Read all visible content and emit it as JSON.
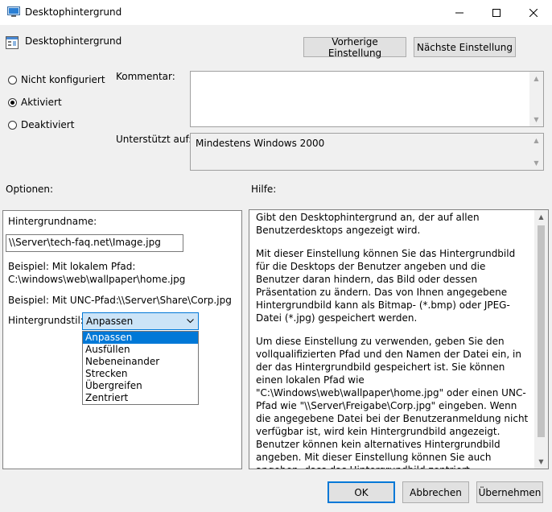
{
  "window": {
    "title": "Desktophintergrund",
    "minimize_icon": "minimize-icon",
    "maximize_icon": "maximize-icon",
    "close_icon": "close-icon"
  },
  "header": {
    "setting_name": "Desktophintergrund",
    "prev_button": "Vorherige Einstellung",
    "next_button": "Nächste Einstellung"
  },
  "state": {
    "options": [
      {
        "label": "Nicht konfiguriert",
        "checked": false
      },
      {
        "label": "Aktiviert",
        "checked": true
      },
      {
        "label": "Deaktiviert",
        "checked": false
      }
    ]
  },
  "comment": {
    "label": "Kommentar:",
    "value": ""
  },
  "supported": {
    "label": "Unterstützt auf:",
    "value": "Mindestens Windows 2000"
  },
  "options_section": {
    "label": "Optionen:",
    "name_label": "Hintergrundname:",
    "name_value": "\\\\Server\\tech-faq.net\\Image.jpg",
    "example_local_label": "Beispiel: Mit lokalem Pfad:",
    "example_local_value": "C:\\windows\\web\\wallpaper\\home.jpg",
    "example_unc_label": "Beispiel: Mit UNC-Pfad:",
    "example_unc_value": "\\\\Server\\Share\\Corp.jpg",
    "style_label": "Hintergrundstil:",
    "style_selected": "Anpassen",
    "style_options": [
      "Anpassen",
      "Ausfüllen",
      "Nebeneinander",
      "Strecken",
      "Übergreifen",
      "Zentriert"
    ]
  },
  "help_section": {
    "label": "Hilfe:",
    "paragraphs": [
      "Gibt den Desktophintergrund an, der auf allen Benutzerdesktops angezeigt wird.",
      "Mit dieser Einstellung können Sie das Hintergrundbild für die Desktops der Benutzer angeben und die Benutzer daran hindern, das Bild oder dessen Präsentation zu ändern. Das von Ihnen angegebene Hintergrundbild kann als Bitmap- (*.bmp) oder JPEG-Datei (*.jpg) gespeichert werden.",
      "Um diese Einstellung zu verwenden, geben Sie den vollqualifizierten Pfad und den Namen der Datei ein, in der das Hintergrundbild gespeichert ist. Sie können einen lokalen Pfad wie \"C:\\Windows\\web\\wallpaper\\home.jpg\" oder einen UNC-Pfad wie \"\\\\Server\\Freigabe\\Corp.jpg\" eingeben. Wenn die angegebene Datei bei der Benutzeranmeldung nicht verfügbar ist, wird kein Hintergrundbild angezeigt. Benutzer können kein alternatives Hintergrundbild angeben. Mit dieser Einstellung können Sie auch angeben, dass das Hintergrundbild zentriert, nebeneinander wiederholt oder gestreckt angezeigt werden soll. Benutzer können diese Festlegung nicht ändern."
    ]
  },
  "footer": {
    "ok": "OK",
    "cancel": "Abbrechen",
    "apply": "Übernehmen"
  }
}
